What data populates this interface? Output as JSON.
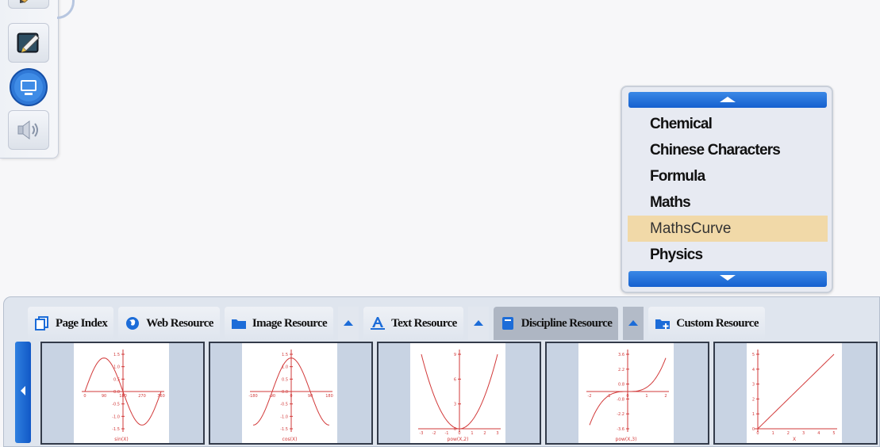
{
  "toolbar": {
    "buttons": [
      {
        "name": "pen-tool"
      },
      {
        "name": "whiteboard"
      },
      {
        "name": "screen"
      },
      {
        "name": "sound"
      }
    ]
  },
  "dropdown": {
    "items": [
      {
        "label": "Chemical",
        "selected": false
      },
      {
        "label": "Chinese Characters",
        "selected": false
      },
      {
        "label": "Formula",
        "selected": false
      },
      {
        "label": "Maths",
        "selected": false
      },
      {
        "label": "MathsCurve",
        "selected": true
      },
      {
        "label": "Physics",
        "selected": false
      }
    ]
  },
  "tabs": [
    {
      "label": "Page Index",
      "icon": "page-index-icon",
      "active": false,
      "has_arrow": false
    },
    {
      "label": "Web Resource",
      "icon": "globe-icon",
      "active": false,
      "has_arrow": false
    },
    {
      "label": "Image Resource",
      "icon": "folder-icon",
      "active": false,
      "has_arrow": true
    },
    {
      "label": "Text Resource",
      "icon": "text-a-icon",
      "active": false,
      "has_arrow": true
    },
    {
      "label": "Discipline Resource",
      "icon": "book-icon",
      "active": true,
      "has_arrow": true
    },
    {
      "label": "Custom Resource",
      "icon": "folder-add-icon",
      "active": false,
      "has_arrow": false
    }
  ],
  "thumbnails": [
    {
      "caption": "sin(X)",
      "yticks": [
        "1.5",
        "1.0",
        "0.5",
        "0.0",
        "-0.5",
        "-1.0",
        "-1.5"
      ],
      "xticks": [
        "0",
        "90",
        "180",
        "270",
        "360"
      ]
    },
    {
      "caption": "cos(X)",
      "yticks": [
        "1.5",
        "1.0",
        "0.5",
        "0.0",
        "-0.5",
        "-1.0",
        "-1.5"
      ],
      "xticks": [
        "-180",
        "-90",
        "0",
        "90",
        "180"
      ]
    },
    {
      "caption": "pow(X,2)",
      "yticks": [
        "9",
        "6",
        "3",
        "0"
      ],
      "xticks": [
        "-3",
        "-2",
        "-1",
        "0",
        "1",
        "2",
        "3"
      ]
    },
    {
      "caption": "pow(X,3)",
      "yticks": [
        "3.6",
        "2.2",
        "0.8",
        "-0.8",
        "-2.2",
        "-3.6"
      ],
      "xticks": [
        "-2",
        "-1",
        "0",
        "1",
        "2"
      ]
    },
    {
      "caption": "X",
      "yticks": [
        "5",
        "4",
        "3",
        "2",
        "1",
        "0"
      ],
      "xticks": [
        "0",
        "1",
        "2",
        "3",
        "4",
        "5"
      ]
    }
  ],
  "colors": {
    "accent": "#1c6cd8",
    "selection": "#f1d9a8",
    "curve": "#d23a3a"
  }
}
